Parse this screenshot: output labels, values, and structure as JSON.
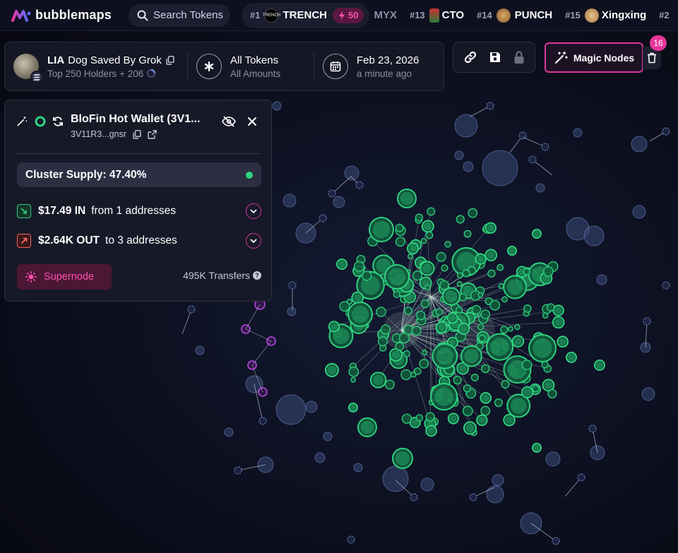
{
  "app": {
    "name": "bubblemaps",
    "search_placeholder": "Search Tokens"
  },
  "trending": [
    {
      "rank": "#1",
      "name": "TRENCH",
      "boost": "50",
      "icon": "trench-token-icon",
      "icon_text": "TRENCH"
    },
    {
      "rank": "",
      "name": "MYX"
    },
    {
      "rank": "#13",
      "name": "CTO",
      "icon": "cto-token-icon"
    },
    {
      "rank": "#14",
      "name": "PUNCH",
      "icon": "punch-token-icon"
    },
    {
      "rank": "#15",
      "name": "Xingxing",
      "icon": "xingxing-token-icon"
    },
    {
      "rank": "#2",
      "name": ""
    }
  ],
  "token": {
    "symbol": "LIA",
    "name": "Dog Saved By Grok",
    "holders": "Top 250 Holders + 206",
    "filter_title": "All Tokens",
    "filter_sub": "All Amounts",
    "date": "Feb 23, 2026",
    "updated": "a minute ago"
  },
  "toolbar": {
    "magic_label": "Magic Nodes",
    "magic_count": "16"
  },
  "wallet": {
    "name": "BloFin Hot Wallet (3V1...",
    "address": "3V11R3...gnsr",
    "cluster_supply": "Cluster Supply: 47.40%",
    "in_amount": "$17.49 IN",
    "in_text": "from 1 addresses",
    "out_amount": "$2.64K OUT",
    "out_text": "to 3 addresses",
    "supernode_label": "Supernode",
    "transfers": "495K Transfers"
  },
  "colors": {
    "accent": "#e8359b",
    "node_green": "#2fd17f",
    "node_blue": "#3a4a78",
    "node_purple": "#b44ae0",
    "in_green": "#2fd17f",
    "out_red": "#ff5f5f"
  }
}
